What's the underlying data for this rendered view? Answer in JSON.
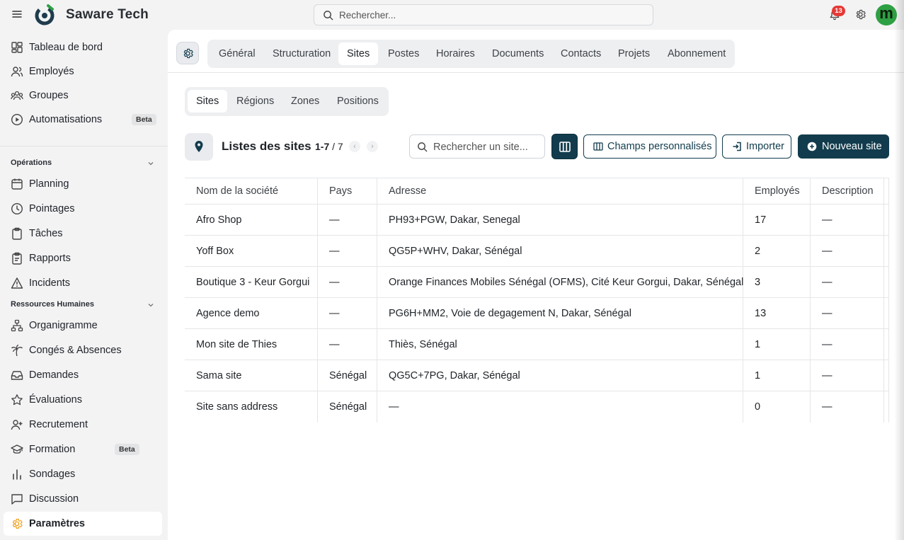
{
  "app": {
    "brand": "Saware Tech",
    "search_placeholder": "Rechercher...",
    "notification_count": "13",
    "avatar_letter": "m"
  },
  "sidebar": {
    "top_items": [
      {
        "label": "Tableau de bord",
        "icon": "dashboard-icon"
      },
      {
        "label": "Employés",
        "icon": "users-icon"
      },
      {
        "label": "Groupes",
        "icon": "groups-icon"
      },
      {
        "label": "Automatisations",
        "icon": "play-circle-icon",
        "badge": "Beta"
      }
    ],
    "sections": [
      {
        "title": "Opérations",
        "items": [
          {
            "label": "Planning",
            "icon": "calendar-icon"
          },
          {
            "label": "Pointages",
            "icon": "clock-icon"
          },
          {
            "label": "Tâches",
            "icon": "clipboard-icon"
          },
          {
            "label": "Rapports",
            "icon": "report-icon"
          },
          {
            "label": "Incidents",
            "icon": "warning-icon"
          }
        ]
      },
      {
        "title": "Ressources Humaines",
        "items": [
          {
            "label": "Organigramme",
            "icon": "org-chart-icon"
          },
          {
            "label": "Congés & Absences",
            "icon": "palm-tree-icon"
          },
          {
            "label": "Demandes",
            "icon": "inbox-icon"
          },
          {
            "label": "Évaluations",
            "icon": "star-icon"
          },
          {
            "label": "Recrutement",
            "icon": "user-plus-icon"
          },
          {
            "label": "Formation",
            "icon": "graduation-cap-icon",
            "badge": "Beta"
          },
          {
            "label": "Sondages",
            "icon": "bar-chart-icon"
          },
          {
            "label": "Discussion",
            "icon": "message-icon"
          },
          {
            "label": "Paramètres",
            "icon": "gear-icon",
            "active": true
          }
        ]
      }
    ]
  },
  "tabs": [
    "Général",
    "Structuration",
    "Sites",
    "Postes",
    "Horaires",
    "Documents",
    "Contacts",
    "Projets",
    "Abonnement"
  ],
  "active_tab": "Sites",
  "subtabs": [
    "Sites",
    "Régions",
    "Zones",
    "Positions"
  ],
  "active_subtab": "Sites",
  "list": {
    "title": "Listes des sites",
    "range": "1-7",
    "total": "/ 7",
    "search_placeholder": "Rechercher un site...",
    "custom_fields_label": "Champs personnalisés",
    "import_label": "Importer",
    "new_label": "Nouveau site"
  },
  "table": {
    "columns": [
      "Nom de la société",
      "Pays",
      "Adresse",
      "Employés",
      "Description"
    ],
    "rows": [
      [
        "Afro Shop",
        "—",
        "PH93+PGW, Dakar, Senegal",
        "17",
        "—"
      ],
      [
        "Yoff Box",
        "—",
        "QG5P+WHV, Dakar, Sénégal",
        "2",
        "—"
      ],
      [
        "Boutique 3 - Keur Gorgui",
        "—",
        "Orange Finances Mobiles Sénégal (OFMS), Cité Keur Gorgui, Dakar, Sénégal",
        "3",
        "—"
      ],
      [
        "Agence demo",
        "—",
        "PG6H+MM2, Voie de degagement N, Dakar, Sénégal",
        "13",
        "—"
      ],
      [
        "Mon site de Thies",
        "—",
        "Thiès, Sénégal",
        "1",
        "—"
      ],
      [
        "Sama site",
        "Sénégal",
        "QG5C+7PG, Dakar, Sénégal",
        "1",
        "—"
      ],
      [
        "Site sans address",
        "Sénégal",
        "—",
        "0",
        "—"
      ]
    ]
  },
  "colors": {
    "primary": "#123c4d",
    "accent": "#f0a020",
    "badge": "#e53935",
    "avatar": "#2ea043"
  }
}
